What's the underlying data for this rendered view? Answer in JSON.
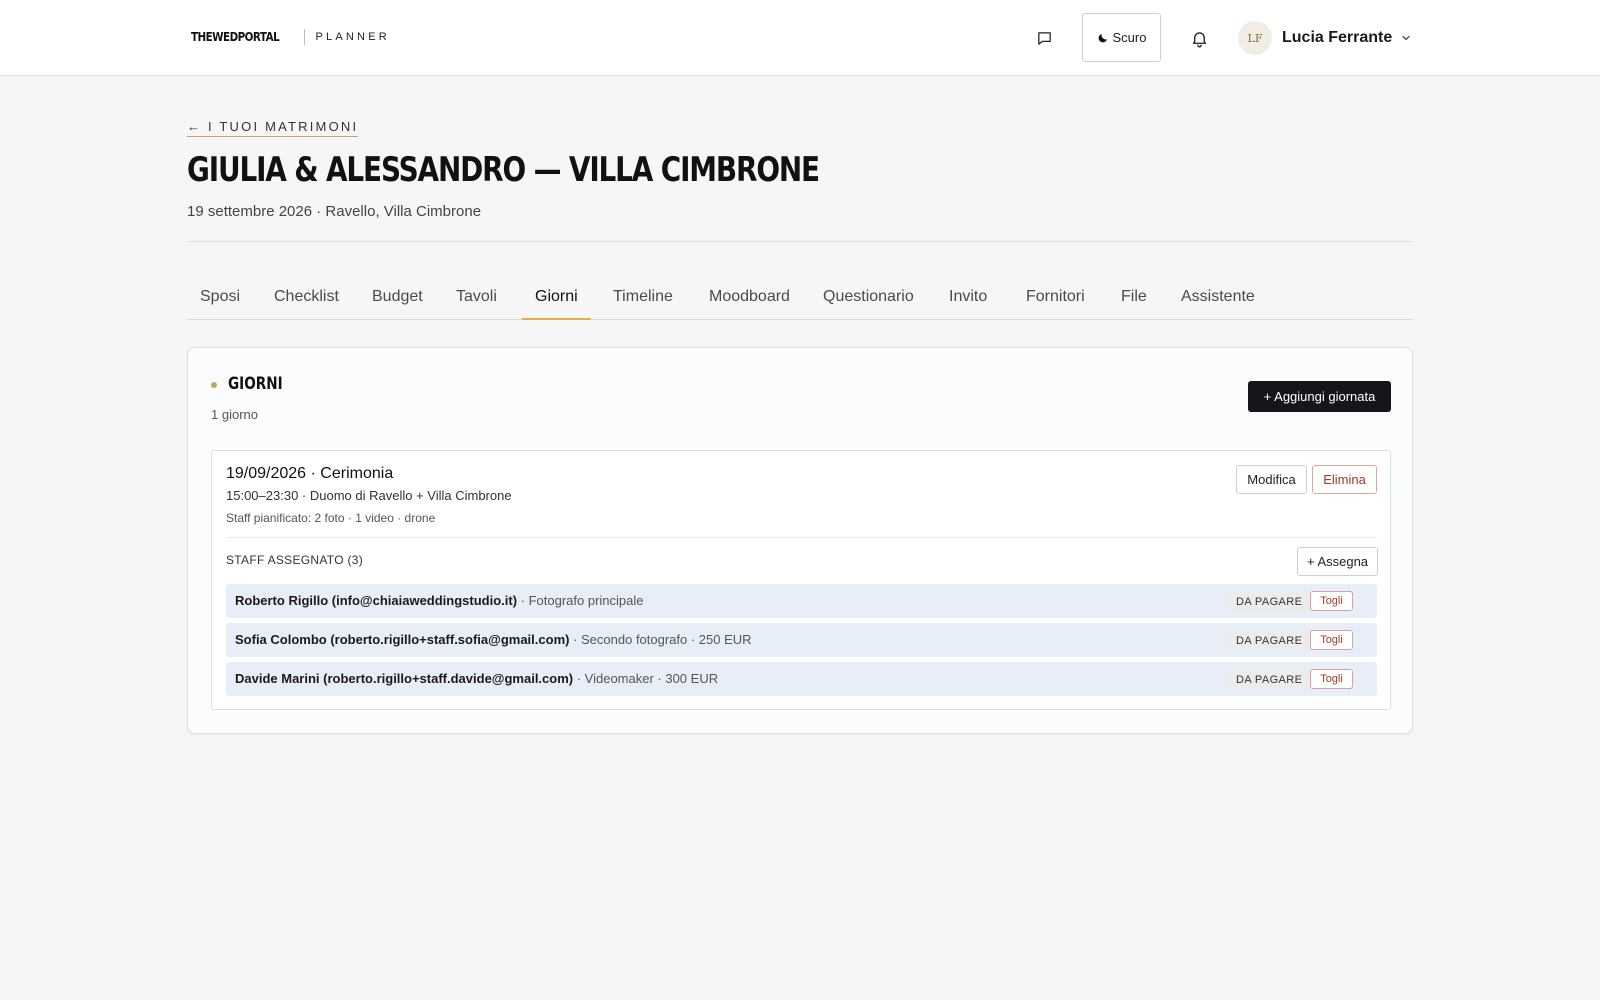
{
  "header": {
    "logo_main": "THEWEDPORTAL",
    "logo_sub": "PLANNER",
    "theme_label": "Scuro",
    "user": {
      "initials": "LF",
      "name": "Lucia Ferrante"
    }
  },
  "page": {
    "back_label": "← I TUOI MATRIMONI",
    "title": "GIULIA & ALESSANDRO — VILLA CIMBRONE",
    "subtitle": "19 settembre 2026 · Ravello, Villa Cimbrone"
  },
  "tabs": [
    {
      "label": "Sposi"
    },
    {
      "label": "Checklist"
    },
    {
      "label": "Budget"
    },
    {
      "label": "Tavoli"
    },
    {
      "label": "Giorni",
      "active": true
    },
    {
      "label": "Timeline"
    },
    {
      "label": "Moodboard"
    },
    {
      "label": "Questionario"
    },
    {
      "label": "Invito"
    },
    {
      "label": "Fornitori"
    },
    {
      "label": "File"
    },
    {
      "label": "Assistente"
    }
  ],
  "section": {
    "title": "GIORNI",
    "count": "1 giorno",
    "add_label": "+ Aggiungi giornata"
  },
  "day": {
    "title": "19/09/2026 · Cerimonia",
    "time_place": "15:00–23:30 · Duomo di Ravello + Villa Cimbrone",
    "planned_staff": "Staff pianificato: 2 foto · 1 video · drone",
    "edit_label": "Modifica",
    "delete_label": "Elimina",
    "assigned_label": "STAFF ASSEGNATO (3)",
    "assign_label": "+ Assegna",
    "staff": [
      {
        "name": "Roberto Rigillo (info@chiaiaweddingstudio.it)",
        "meta": " · Fotografo principale",
        "status": "DA PAGARE",
        "remove": "Togli"
      },
      {
        "name": "Sofia Colombo (roberto.rigillo+staff.sofia@gmail.com)",
        "meta": " · Secondo fotografo · 250 EUR",
        "status": "DA PAGARE",
        "remove": "Togli"
      },
      {
        "name": "Davide Marini (roberto.rigillo+staff.davide@gmail.com)",
        "meta": " · Videomaker · 300 EUR",
        "status": "DA PAGARE",
        "remove": "Togli"
      }
    ]
  }
}
